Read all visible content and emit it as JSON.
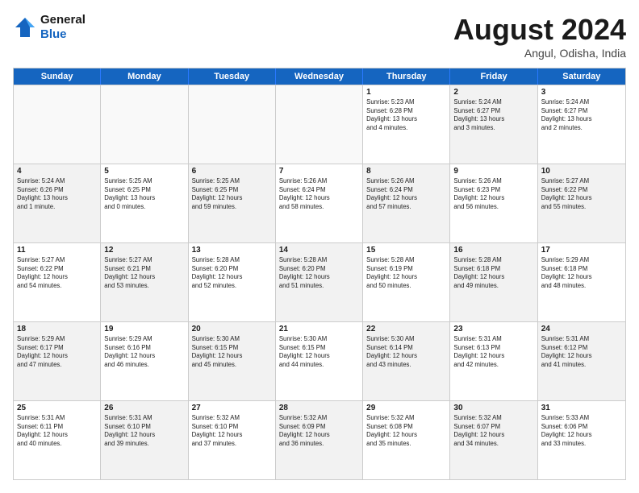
{
  "logo": {
    "line1": "General",
    "line2": "Blue"
  },
  "title": "August 2024",
  "subtitle": "Angul, Odisha, India",
  "weekdays": [
    "Sunday",
    "Monday",
    "Tuesday",
    "Wednesday",
    "Thursday",
    "Friday",
    "Saturday"
  ],
  "rows": [
    [
      {
        "day": "",
        "info": "",
        "shaded": false,
        "empty": true
      },
      {
        "day": "",
        "info": "",
        "shaded": false,
        "empty": true
      },
      {
        "day": "",
        "info": "",
        "shaded": false,
        "empty": true
      },
      {
        "day": "",
        "info": "",
        "shaded": false,
        "empty": true
      },
      {
        "day": "1",
        "info": "Sunrise: 5:23 AM\nSunset: 6:28 PM\nDaylight: 13 hours\nand 4 minutes.",
        "shaded": false,
        "empty": false
      },
      {
        "day": "2",
        "info": "Sunrise: 5:24 AM\nSunset: 6:27 PM\nDaylight: 13 hours\nand 3 minutes.",
        "shaded": true,
        "empty": false
      },
      {
        "day": "3",
        "info": "Sunrise: 5:24 AM\nSunset: 6:27 PM\nDaylight: 13 hours\nand 2 minutes.",
        "shaded": false,
        "empty": false
      }
    ],
    [
      {
        "day": "4",
        "info": "Sunrise: 5:24 AM\nSunset: 6:26 PM\nDaylight: 13 hours\nand 1 minute.",
        "shaded": true,
        "empty": false
      },
      {
        "day": "5",
        "info": "Sunrise: 5:25 AM\nSunset: 6:25 PM\nDaylight: 13 hours\nand 0 minutes.",
        "shaded": false,
        "empty": false
      },
      {
        "day": "6",
        "info": "Sunrise: 5:25 AM\nSunset: 6:25 PM\nDaylight: 12 hours\nand 59 minutes.",
        "shaded": true,
        "empty": false
      },
      {
        "day": "7",
        "info": "Sunrise: 5:26 AM\nSunset: 6:24 PM\nDaylight: 12 hours\nand 58 minutes.",
        "shaded": false,
        "empty": false
      },
      {
        "day": "8",
        "info": "Sunrise: 5:26 AM\nSunset: 6:24 PM\nDaylight: 12 hours\nand 57 minutes.",
        "shaded": true,
        "empty": false
      },
      {
        "day": "9",
        "info": "Sunrise: 5:26 AM\nSunset: 6:23 PM\nDaylight: 12 hours\nand 56 minutes.",
        "shaded": false,
        "empty": false
      },
      {
        "day": "10",
        "info": "Sunrise: 5:27 AM\nSunset: 6:22 PM\nDaylight: 12 hours\nand 55 minutes.",
        "shaded": true,
        "empty": false
      }
    ],
    [
      {
        "day": "11",
        "info": "Sunrise: 5:27 AM\nSunset: 6:22 PM\nDaylight: 12 hours\nand 54 minutes.",
        "shaded": false,
        "empty": false
      },
      {
        "day": "12",
        "info": "Sunrise: 5:27 AM\nSunset: 6:21 PM\nDaylight: 12 hours\nand 53 minutes.",
        "shaded": true,
        "empty": false
      },
      {
        "day": "13",
        "info": "Sunrise: 5:28 AM\nSunset: 6:20 PM\nDaylight: 12 hours\nand 52 minutes.",
        "shaded": false,
        "empty": false
      },
      {
        "day": "14",
        "info": "Sunrise: 5:28 AM\nSunset: 6:20 PM\nDaylight: 12 hours\nand 51 minutes.",
        "shaded": true,
        "empty": false
      },
      {
        "day": "15",
        "info": "Sunrise: 5:28 AM\nSunset: 6:19 PM\nDaylight: 12 hours\nand 50 minutes.",
        "shaded": false,
        "empty": false
      },
      {
        "day": "16",
        "info": "Sunrise: 5:28 AM\nSunset: 6:18 PM\nDaylight: 12 hours\nand 49 minutes.",
        "shaded": true,
        "empty": false
      },
      {
        "day": "17",
        "info": "Sunrise: 5:29 AM\nSunset: 6:18 PM\nDaylight: 12 hours\nand 48 minutes.",
        "shaded": false,
        "empty": false
      }
    ],
    [
      {
        "day": "18",
        "info": "Sunrise: 5:29 AM\nSunset: 6:17 PM\nDaylight: 12 hours\nand 47 minutes.",
        "shaded": true,
        "empty": false
      },
      {
        "day": "19",
        "info": "Sunrise: 5:29 AM\nSunset: 6:16 PM\nDaylight: 12 hours\nand 46 minutes.",
        "shaded": false,
        "empty": false
      },
      {
        "day": "20",
        "info": "Sunrise: 5:30 AM\nSunset: 6:15 PM\nDaylight: 12 hours\nand 45 minutes.",
        "shaded": true,
        "empty": false
      },
      {
        "day": "21",
        "info": "Sunrise: 5:30 AM\nSunset: 6:15 PM\nDaylight: 12 hours\nand 44 minutes.",
        "shaded": false,
        "empty": false
      },
      {
        "day": "22",
        "info": "Sunrise: 5:30 AM\nSunset: 6:14 PM\nDaylight: 12 hours\nand 43 minutes.",
        "shaded": true,
        "empty": false
      },
      {
        "day": "23",
        "info": "Sunrise: 5:31 AM\nSunset: 6:13 PM\nDaylight: 12 hours\nand 42 minutes.",
        "shaded": false,
        "empty": false
      },
      {
        "day": "24",
        "info": "Sunrise: 5:31 AM\nSunset: 6:12 PM\nDaylight: 12 hours\nand 41 minutes.",
        "shaded": true,
        "empty": false
      }
    ],
    [
      {
        "day": "25",
        "info": "Sunrise: 5:31 AM\nSunset: 6:11 PM\nDaylight: 12 hours\nand 40 minutes.",
        "shaded": false,
        "empty": false
      },
      {
        "day": "26",
        "info": "Sunrise: 5:31 AM\nSunset: 6:10 PM\nDaylight: 12 hours\nand 39 minutes.",
        "shaded": true,
        "empty": false
      },
      {
        "day": "27",
        "info": "Sunrise: 5:32 AM\nSunset: 6:10 PM\nDaylight: 12 hours\nand 37 minutes.",
        "shaded": false,
        "empty": false
      },
      {
        "day": "28",
        "info": "Sunrise: 5:32 AM\nSunset: 6:09 PM\nDaylight: 12 hours\nand 36 minutes.",
        "shaded": true,
        "empty": false
      },
      {
        "day": "29",
        "info": "Sunrise: 5:32 AM\nSunset: 6:08 PM\nDaylight: 12 hours\nand 35 minutes.",
        "shaded": false,
        "empty": false
      },
      {
        "day": "30",
        "info": "Sunrise: 5:32 AM\nSunset: 6:07 PM\nDaylight: 12 hours\nand 34 minutes.",
        "shaded": true,
        "empty": false
      },
      {
        "day": "31",
        "info": "Sunrise: 5:33 AM\nSunset: 6:06 PM\nDaylight: 12 hours\nand 33 minutes.",
        "shaded": false,
        "empty": false
      }
    ]
  ]
}
